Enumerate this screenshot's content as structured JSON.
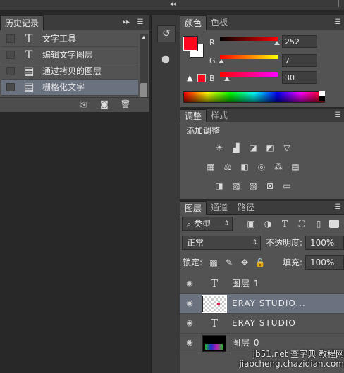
{
  "history": {
    "tab": "历史记录",
    "items": [
      {
        "icon": "text-tool-icon",
        "label": "文字工具",
        "selected": false
      },
      {
        "icon": "text-tool-icon",
        "label": "编辑文字图层",
        "selected": false
      },
      {
        "icon": "document-icon",
        "label": "通过拷贝的图层",
        "selected": false
      },
      {
        "icon": "document-icon",
        "label": "栅格化文字",
        "selected": true
      }
    ]
  },
  "color": {
    "tabs": [
      "颜色",
      "色板"
    ],
    "foreground": "#fc071e",
    "background": "#ffffff",
    "channels": [
      {
        "label": "R",
        "value": "252",
        "level": 252
      },
      {
        "label": "G",
        "value": "7",
        "level": 7
      },
      {
        "label": "B",
        "value": "30",
        "level": 30
      }
    ]
  },
  "adjustments": {
    "tabs": [
      "调整",
      "样式"
    ],
    "title": "添加调整"
  },
  "layers": {
    "tabs": [
      "图层",
      "通道",
      "路径"
    ],
    "filter_label": "类型",
    "blend_mode": "正常",
    "opacity_label": "不透明度:",
    "opacity_value": "100%",
    "lock_label": "锁定:",
    "fill_label": "填充:",
    "fill_value": "100%",
    "items": [
      {
        "type": "text",
        "name": "图层 1",
        "selected": false
      },
      {
        "type": "raster",
        "name": "ERAY  STUDIO...",
        "selected": true
      },
      {
        "type": "text",
        "name": "ERAY  STUDIO",
        "selected": false
      },
      {
        "type": "image",
        "name": "图层 0",
        "selected": false
      }
    ]
  },
  "watermark": "jb51.net  查字典 教程网  jiaocheng.chazidian.com"
}
